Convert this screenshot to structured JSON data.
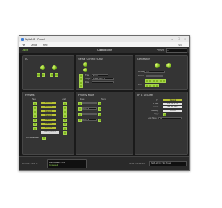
{
  "window": {
    "title": "DigitalVIP - Control"
  },
  "menubar": {
    "items": [
      "File",
      "Device",
      "Help"
    ],
    "right_text": "v1.0"
  },
  "toolbar": {
    "status": "Online",
    "center_title": "Control Editor",
    "preset_label": "Preset",
    "preset_value": "--"
  },
  "panels": {
    "io": {
      "title": "I/O"
    },
    "serial": {
      "title": "Serial Control (Ch1)",
      "type_label": "Type",
      "type_value": "Serial",
      "target_label": "Target",
      "target_value": "DVMX-22 Ch 1",
      "data_label": "Data"
    },
    "generator": {
      "title": "Generator",
      "format_label": "Format",
      "format_value": "Auto",
      "pattern_label": "Pattern",
      "rate_label": "Rate"
    },
    "presets": {
      "title": "Presets",
      "col_save": "Save",
      "col_load": "Load",
      "rows": [
        "Preset 1",
        "Preset 2",
        "Preset 3",
        "Preset 4",
        "Preset 5",
        "Preset 6",
        "Preset 7",
        "Factory Default"
      ],
      "remote_enable_label": "Remote Enable"
    },
    "priority": {
      "title": "Priority Mute",
      "col_mode": "Mode",
      "col_name": "Name",
      "rows": [
        "Default",
        "Default",
        "Default",
        "Default"
      ]
    },
    "ip": {
      "title": "IP & Security",
      "fields": [
        {
          "label": "IP",
          "value": "Manual"
        },
        {
          "label": "IP Addr",
          "value": "192.168.1.254"
        },
        {
          "label": "Subnet",
          "value": "255.255.255.0"
        },
        {
          "label": "Gateway",
          "value": "0.0.0.0"
        },
        {
          "label": "Apply",
          "value": ""
        }
      ],
      "lock_label": "Lock Mode",
      "lock_value": "Off"
    }
  },
  "bottom": {
    "device_label": "DEVICE STATUS",
    "device_value": "Link DigitalVIP  Ch1",
    "device_sub": "Connected",
    "last_cmd_label": "LAST COMMAND",
    "last_cmd_value": "DVMX-22 Ch 1 Set Preset"
  },
  "colors": {
    "accent_green": "#7fb51f",
    "accent_yellow": "#b9c233",
    "panel_bg": "#343434",
    "app_bg": "#1a1a1a"
  }
}
